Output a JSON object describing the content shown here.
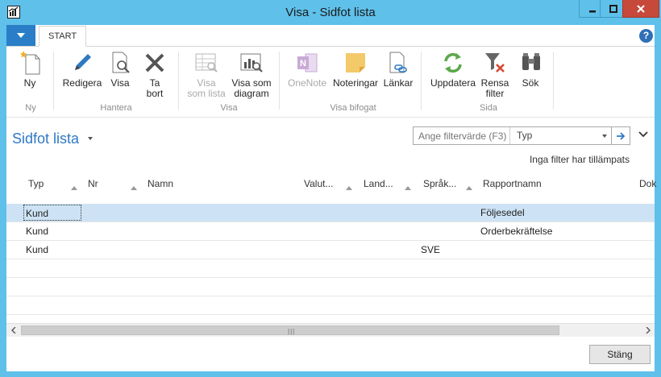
{
  "window": {
    "title": "Visa - Sidfot lista",
    "min_glyph": "—",
    "max_glyph": "☐",
    "close_glyph": "✕"
  },
  "ribbon": {
    "tab": "START",
    "help": "?",
    "groups": {
      "ny": "Ny",
      "hantera": "Hantera",
      "visa": "Visa",
      "visa_bifogat": "Visa bifogat",
      "sida": "Sida"
    },
    "buttons": {
      "ny": "Ny",
      "redigera": "Redigera",
      "visa": "Visa",
      "ta_bort_1": "Ta",
      "ta_bort_2": "bort",
      "visa_som_lista_1": "Visa",
      "visa_som_lista_2": "som lista",
      "visa_som_diagram_1": "Visa som",
      "visa_som_diagram_2": "diagram",
      "onenote": "OneNote",
      "noteringar": "Noteringar",
      "lankar": "Länkar",
      "uppdatera": "Uppdatera",
      "rensa_filter_1": "Rensa",
      "rensa_filter_2": "filter",
      "sok": "Sök"
    }
  },
  "page": {
    "title": "Sidfot lista",
    "filter_placeholder": "Ange filtervärde (F3)",
    "filter_field": "Typ",
    "no_filter": "Inga filter har tillämpats"
  },
  "grid": {
    "columns": {
      "typ": "Typ",
      "nr": "Nr",
      "namn": "Namn",
      "valuta": "Valut...",
      "land": "Land...",
      "sprak": "Språk...",
      "rapportnamn": "Rapportnamn",
      "dok": "Dok"
    },
    "rows": [
      {
        "typ": "Kund",
        "sprak": "",
        "rapportnamn": "Följesedel"
      },
      {
        "typ": "Kund",
        "sprak": "",
        "rapportnamn": "Orderbekräftelse"
      },
      {
        "typ": "Kund",
        "sprak": "SVE",
        "rapportnamn": ""
      }
    ]
  },
  "footer": {
    "close": "Stäng"
  },
  "colors": {
    "frame": "#5fc0ea",
    "accent": "#2f79c4",
    "selected_row": "#cde3f5",
    "close_button": "#c7493b"
  }
}
